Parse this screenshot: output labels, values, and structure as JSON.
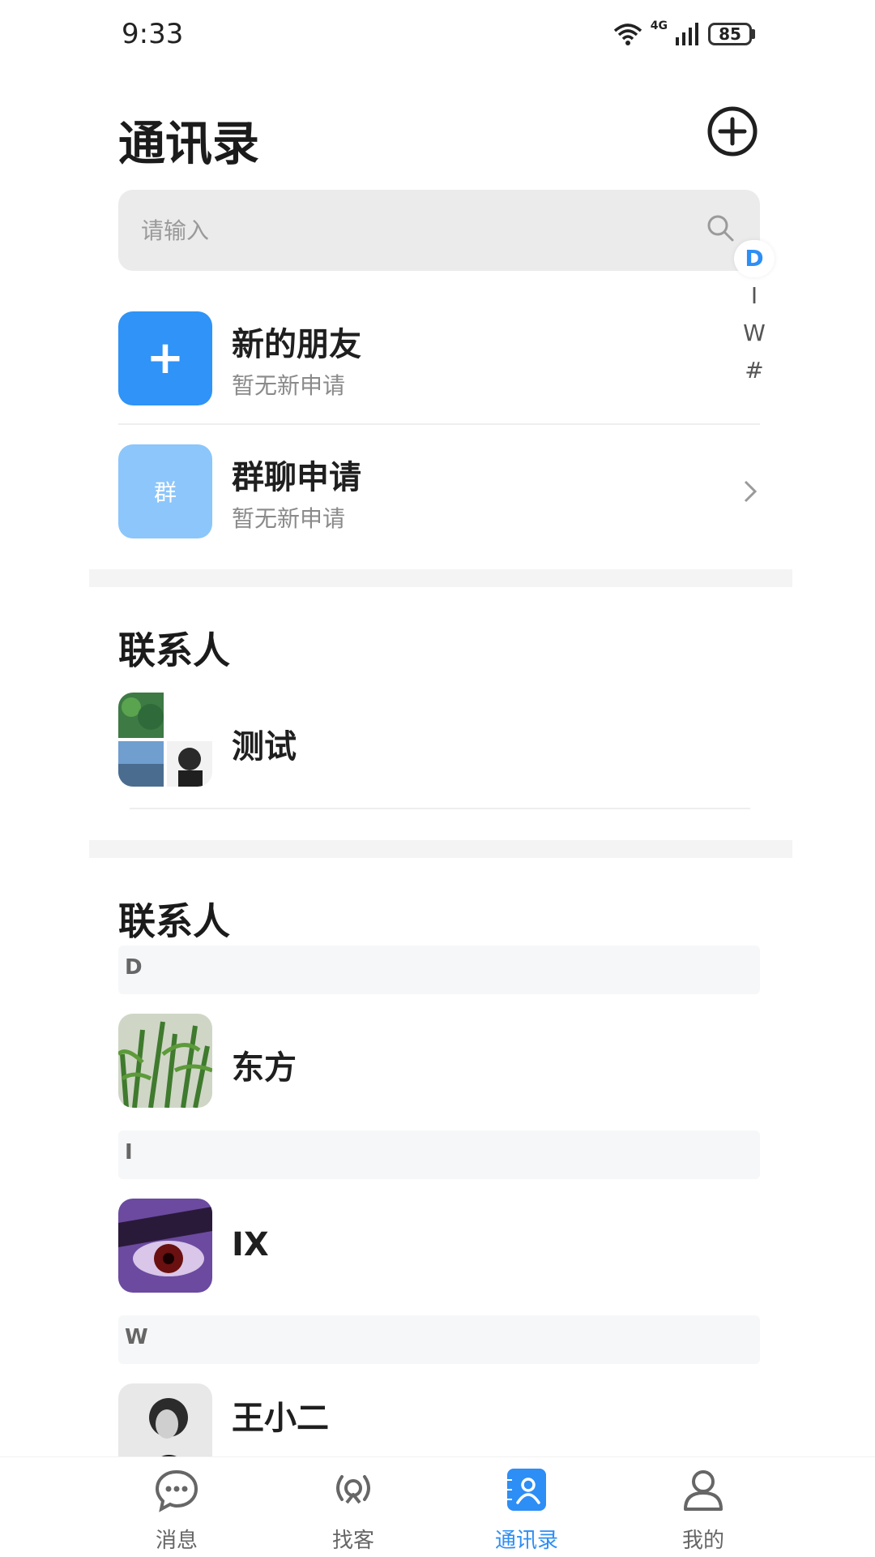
{
  "status_bar": {
    "time": "9:33",
    "network": "4G",
    "battery": "85"
  },
  "header": {
    "title": "通讯录",
    "add_icon": "plus-circle-icon"
  },
  "search": {
    "placeholder": "请输入",
    "icon": "search-icon"
  },
  "alpha_index": [
    "D",
    "I",
    "W",
    "#"
  ],
  "alpha_index_active": "D",
  "requests": [
    {
      "title": "新的朋友",
      "subtitle": "暂无新申请",
      "tile_icon": "plus-icon"
    },
    {
      "title": "群聊申请",
      "subtitle": "暂无新申请",
      "tile_text": "群"
    }
  ],
  "groups_section": {
    "title": "联系人",
    "items": [
      {
        "name": "测试"
      }
    ]
  },
  "contacts_section": {
    "title": "联系人",
    "letters": [
      "D",
      "I",
      "W"
    ],
    "contacts": [
      {
        "letter": "D",
        "name": "东方"
      },
      {
        "letter": "I",
        "name": "IX"
      },
      {
        "letter": "W",
        "name": "王小二"
      }
    ]
  },
  "bottom_nav": [
    {
      "label": "消息",
      "icon": "chat-bubble-icon",
      "active": false
    },
    {
      "label": "找客",
      "icon": "broadcast-icon",
      "active": false
    },
    {
      "label": "通讯录",
      "icon": "contacts-book-icon",
      "active": true
    },
    {
      "label": "我的",
      "icon": "user-profile-icon",
      "active": false
    }
  ],
  "colors": {
    "accent": "#2d8ef5",
    "tile_blue": "#2f93f7",
    "tile_light_blue": "#8cc6fb"
  }
}
